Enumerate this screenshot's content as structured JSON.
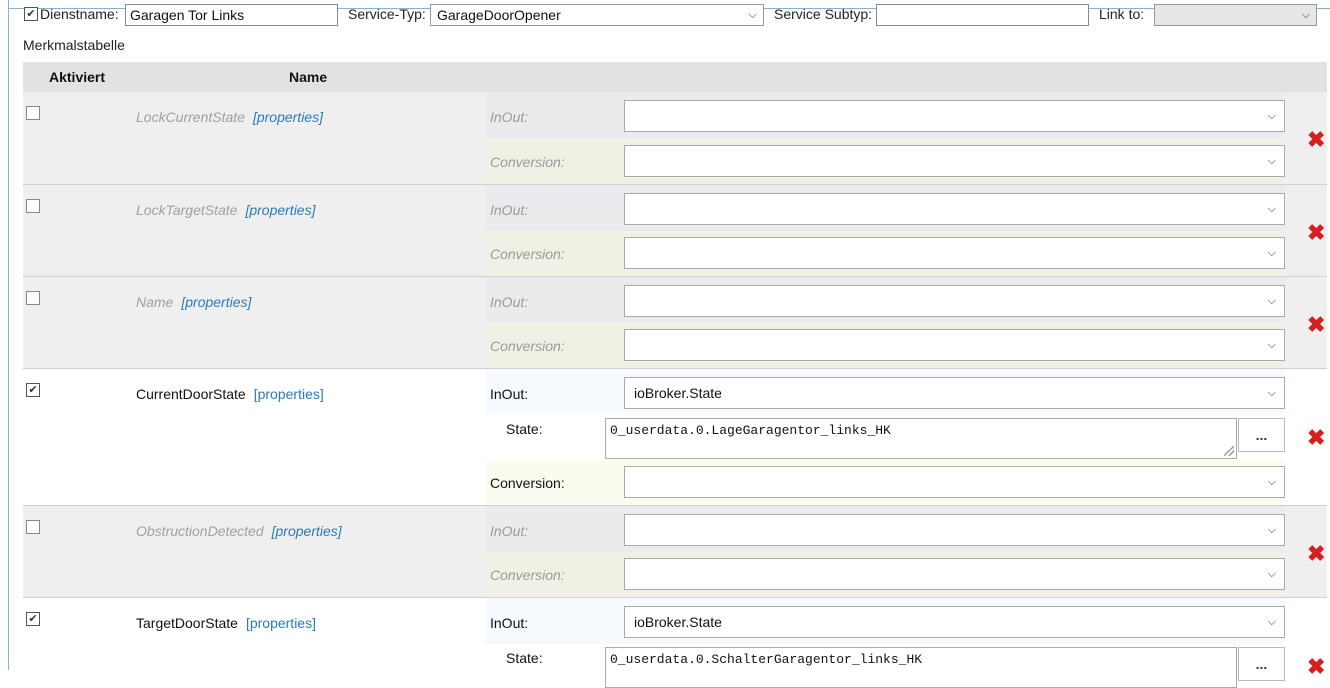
{
  "header": {
    "service_enabled": true,
    "service_name_label": "Dienstname:",
    "service_name_value": "Garagen Tor Links",
    "service_type_label": "Service-Typ:",
    "service_type_value": "GarageDoorOpener",
    "service_subtype_label": "Service Subtyp:",
    "service_subtype_value": "",
    "link_to_label": "Link to:",
    "link_to_value": ""
  },
  "table": {
    "section_label": "Merkmalstabelle",
    "columns": [
      "Aktiviert",
      "Name"
    ],
    "inout_label": "InOut:",
    "conversion_label": "Conversion:",
    "state_label": "State:",
    "properties_label": "[properties]",
    "dots_label": "...",
    "rows": [
      {
        "name": "LockCurrentState",
        "enabled": false,
        "inout": "",
        "conversion": ""
      },
      {
        "name": "LockTargetState",
        "enabled": false,
        "inout": "",
        "conversion": ""
      },
      {
        "name": "Name",
        "enabled": false,
        "inout": "",
        "conversion": ""
      },
      {
        "name": "CurrentDoorState",
        "enabled": true,
        "inout": "ioBroker.State",
        "state": "0_userdata.0.LageGaragentor_links_HK",
        "conversion": ""
      },
      {
        "name": "ObstructionDetected",
        "enabled": false,
        "inout": "",
        "conversion": ""
      },
      {
        "name": "TargetDoorState",
        "enabled": true,
        "inout": "ioBroker.State",
        "state": "0_userdata.0.SchalterGaragentor_links_HK"
      }
    ]
  }
}
